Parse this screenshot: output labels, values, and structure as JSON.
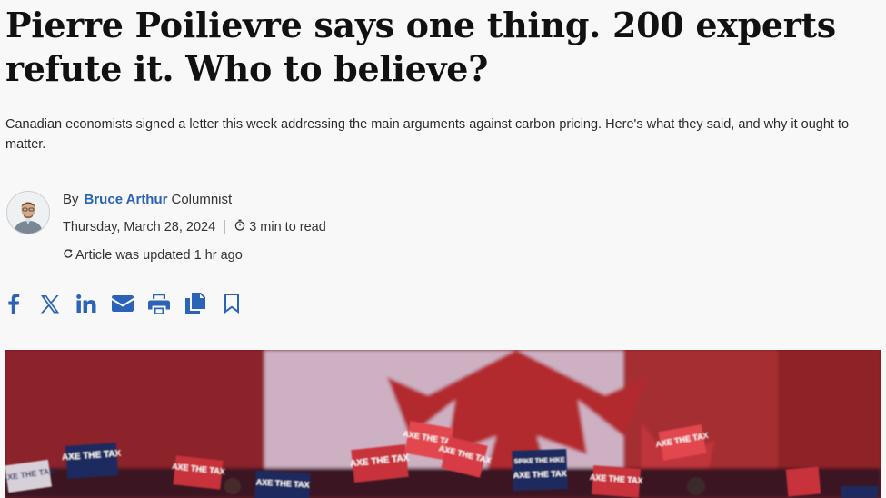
{
  "article": {
    "headline": "Pierre Poilievre says one thing. 200 experts refute it. Who to believe?",
    "deck": "Canadian economists signed a letter this week addressing the main arguments against carbon pricing. Here's what they said, and why it ought to matter."
  },
  "byline": {
    "prefix": "By",
    "author": "Bruce Arthur",
    "role": "Columnist",
    "date": "Thursday, March 28, 2024",
    "read_time": "3 min to read",
    "updated": "Article was updated 1 hr ago"
  },
  "share_icons": [
    "facebook-icon",
    "x-icon",
    "linkedin-icon",
    "email-icon",
    "print-icon",
    "copy-icon",
    "bookmark-icon"
  ],
  "hero_image": {
    "signs": [
      "AXE THE TAX",
      "AXE THE TAX",
      "AXE THE TAX",
      "AXE THE TAX",
      "AXE THE TAX",
      "AXE THE TAX",
      "AXE THE TAX",
      "AXE THE TAX",
      "AXE THE TAX",
      "AXE THE TAX",
      "SPIKE THE HIKE"
    ]
  },
  "colors": {
    "accent": "#2b63b8",
    "background": "#f8f8f8",
    "flag_red": "#b32a2f",
    "sign_navy": "#1f2a5e"
  }
}
